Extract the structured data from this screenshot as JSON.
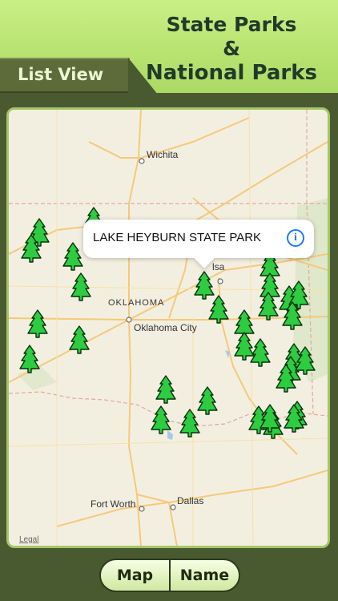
{
  "header": {
    "title_line1": "State Parks",
    "title_line2": "&",
    "title_line3": "National Parks",
    "list_view_label": "List View"
  },
  "map": {
    "callout_name": "LAKE HEYBURN STATE PARK",
    "info_symbol": "i",
    "legal_label": "Legal",
    "labels": {
      "wichita": "Wichita",
      "state": "OKLAHOMA",
      "okc": "Oklahoma City",
      "tulsa": "lsa",
      "fortworth": "Fort Worth",
      "dallas": "Dallas"
    },
    "pin_icon": "tree-icon",
    "pin_color": "#2ecc40"
  },
  "segmented": {
    "map_label": "Map",
    "name_label": "Name"
  }
}
